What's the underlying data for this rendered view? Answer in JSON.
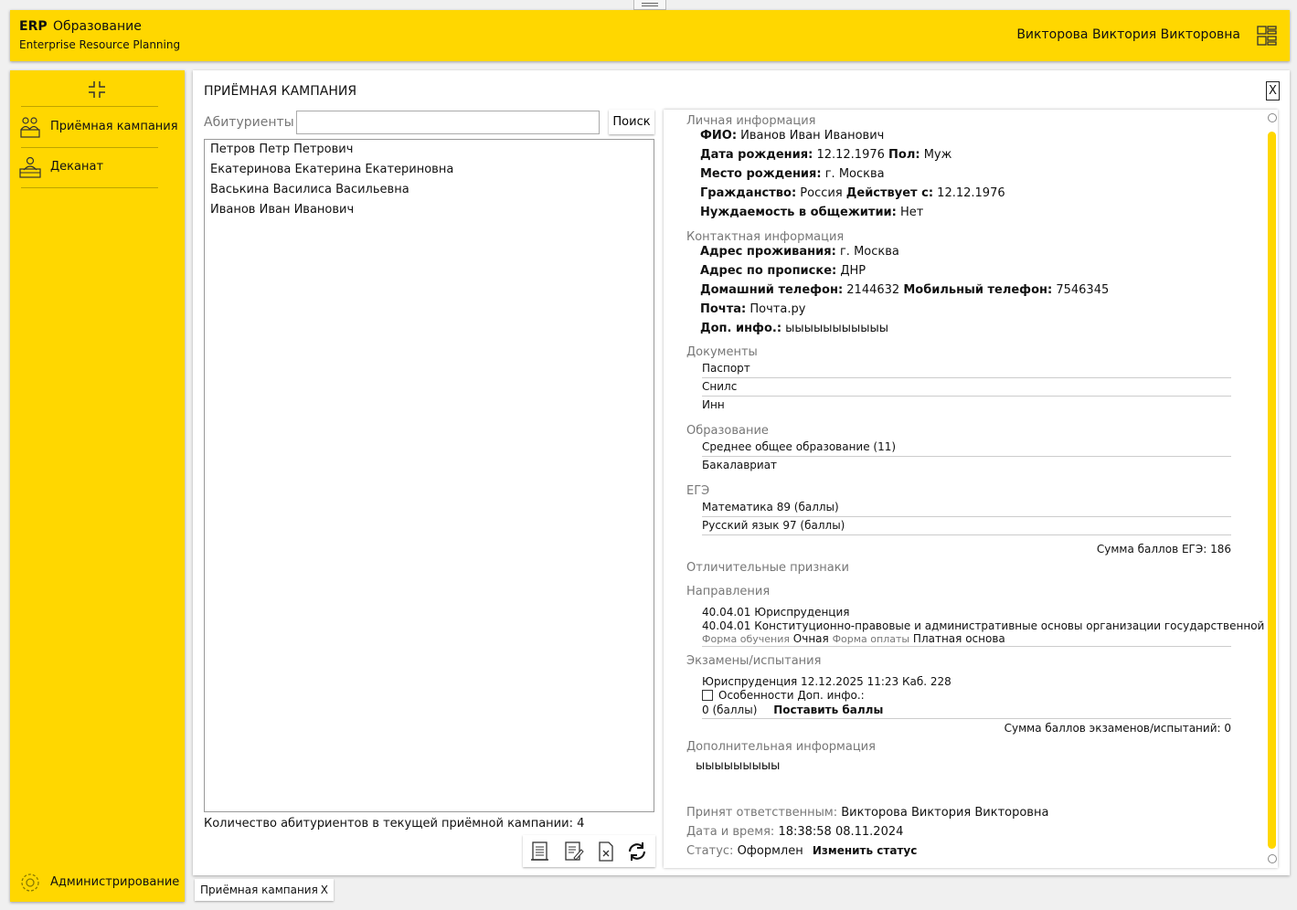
{
  "header": {
    "app_short": "ERP",
    "module": "Образование",
    "subtitle": "Enterprise Resource Planning",
    "user": "Викторова Виктория Викторовна",
    "accent": "#ffd700"
  },
  "sidebar": {
    "items": [
      {
        "label": "Приёмная кампания",
        "icon": "applicants-icon"
      },
      {
        "label": "Деканат",
        "icon": "deanery-icon"
      }
    ],
    "admin_label": "Администрирование"
  },
  "page": {
    "title": "ПРИЁМНАЯ КАМПАНИЯ",
    "close_label": "X"
  },
  "search": {
    "label": "Абитуриенты",
    "value": "",
    "placeholder": "",
    "button": "Поиск"
  },
  "applicants": [
    "Петров Петр Петрович",
    "Екатеринова Екатерина Екатериновна",
    "Васькина Василиса Васильевна",
    "Иванов Иван Иванович"
  ],
  "count_text": "Количество абитуриентов в текущей приёмной кампании: 4",
  "detail": {
    "personal": {
      "title": "Личная информация",
      "fio_label": "ФИО:",
      "fio": "Иванов Иван Иванович",
      "birth_label": "Дата рождения:",
      "birth": "12.12.1976",
      "sex_label": "Пол:",
      "sex": "Муж",
      "place_label": "Место рождения:",
      "place": "г. Москва",
      "citizen_label": "Гражданство:",
      "citizen": "Россия",
      "valid_label": "Действует с:",
      "valid": "12.12.1976",
      "dorm_label": "Нуждаемость в общежитии:",
      "dorm": "Нет"
    },
    "contact": {
      "title": "Контактная информация",
      "addr_label": "Адрес проживания:",
      "addr": "г. Москва",
      "reg_label": "Адрес по прописке:",
      "reg": "ДНР",
      "home_label": "Домашний телефон:",
      "home": "2144632",
      "mobile_label": "Мобильный телефон:",
      "mobile": "7546345",
      "mail_label": "Почта:",
      "mail": "Почта.ру",
      "extra_label": "Доп. инфо.:",
      "extra": "ыыыыыыыыыыы"
    },
    "documents": {
      "title": "Документы",
      "items": [
        "Паспорт",
        "Снилс",
        "Инн"
      ]
    },
    "education": {
      "title": "Образование",
      "items": [
        "Среднее общее образование (11)",
        "Бакалавриат"
      ]
    },
    "ege": {
      "title": "ЕГЭ",
      "items": [
        "Математика 89 (баллы)",
        "Русский язык 97 (баллы)"
      ],
      "sum": "Сумма баллов ЕГЭ: 186"
    },
    "distinct": {
      "title": "Отличительные признаки"
    },
    "directions": {
      "title": "Направления",
      "line1": "40.04.01 Юриспруденция",
      "line2": "40.04.01 Конституционно-правовые и административные основы организации государственной",
      "form_label": "Форма обучения",
      "form": "Очная",
      "pay_label": "Форма оплаты",
      "pay": "Платная основа"
    },
    "exams": {
      "title": "Экзамены/испытания",
      "line": "Юриспруденция 12.12.2025 11:23 Каб. 228",
      "features": "Особенности",
      "extra": "Доп. инфо.:",
      "score": "0 (баллы)",
      "set_scores": "Поставить баллы",
      "sum": "Сумма баллов экзаменов/испытаний: 0"
    },
    "additional": {
      "title": "Дополнительная информация",
      "text": "ыыыыыыыыы"
    },
    "accepted_label": "Принят ответственным:",
    "accepted": "Викторова Виктория Викторовна",
    "datetime_label": "Дата и время:",
    "datetime": "18:38:58 08.11.2024",
    "status_label": "Статус:",
    "status": "Оформлен",
    "change_status": "Изменить статус"
  },
  "toolbar": [
    "list-doc-icon",
    "edit-doc-icon",
    "delete-doc-icon",
    "refresh-icon"
  ],
  "bottom_tab": {
    "label": "Приёмная кампания",
    "close": "X"
  }
}
